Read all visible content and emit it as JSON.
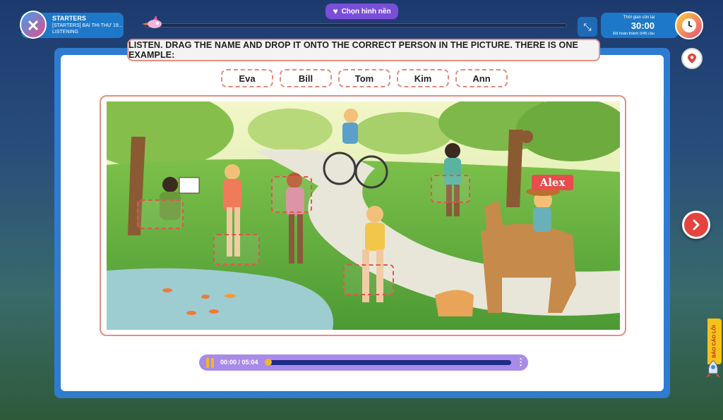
{
  "header": {
    "level": "STARTERS",
    "test_title": "[STARTERS] BÀI THI THỨ 19...",
    "section": "LISTENING",
    "background_button": "Chọn hình nền",
    "timer_label": "Thời gian còn lại",
    "timer_value": "30:00",
    "completed": "Đã hoàn thành 0/45 câu"
  },
  "task": {
    "instruction": "LISTEN. DRAG THE NAME AND DROP IT ONTO THE CORRECT PERSON IN THE PICTURE. THERE IS ONE EXAMPLE:",
    "names": [
      "Eva",
      "Bill",
      "Tom",
      "Kim",
      "Ann"
    ],
    "example_label": "Alex"
  },
  "audio": {
    "time": "00:00 / 05:04",
    "progress": 0
  },
  "side": {
    "report_label": "BÁO CÁO LỖI"
  },
  "colors": {
    "accent": "#2f7bd0",
    "dropzone": "#e0574a",
    "audio_bar": "#a88be8",
    "next_button": "#e5433f"
  },
  "icons": [
    "close-icon",
    "heart-icon",
    "collapse-icon",
    "clock-icon",
    "pin-icon",
    "chevron-right-icon",
    "pause-icon",
    "more-vertical-icon"
  ]
}
